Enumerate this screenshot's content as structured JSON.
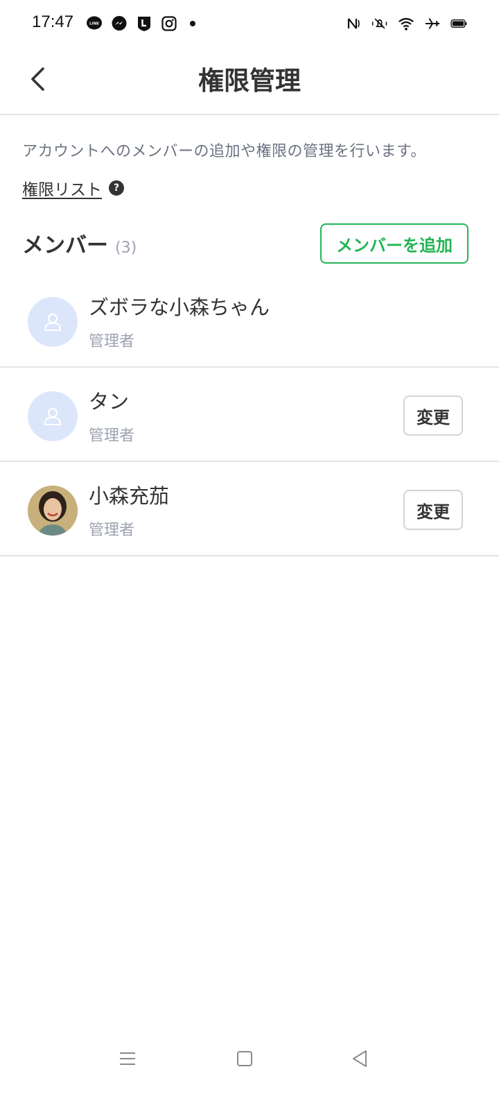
{
  "status_bar": {
    "time": "17:47",
    "left_icons": [
      "line-app-icon",
      "messenger-icon",
      "line-official-icon",
      "instagram-icon"
    ],
    "right_icons": [
      "nfc-icon",
      "mute-icon",
      "wifi-icon",
      "airplane-icon",
      "battery-icon"
    ]
  },
  "header": {
    "title": "権限管理"
  },
  "description": "アカウントへのメンバーの追加や権限の管理を行います。",
  "permission_list": {
    "label": "権限リスト",
    "help": "?"
  },
  "members": {
    "title": "メンバー",
    "count": "(3)",
    "add_button": "メンバーを追加",
    "items": [
      {
        "name": "ズボラな小森ちゃん",
        "role": "管理者",
        "avatar": "default",
        "change_label": ""
      },
      {
        "name": "タン",
        "role": "管理者",
        "avatar": "default",
        "change_label": "変更"
      },
      {
        "name": "小森充茄",
        "role": "管理者",
        "avatar": "photo",
        "change_label": "変更"
      }
    ]
  },
  "colors": {
    "accent": "#22b455",
    "avatar_bg": "#dce6fb"
  }
}
